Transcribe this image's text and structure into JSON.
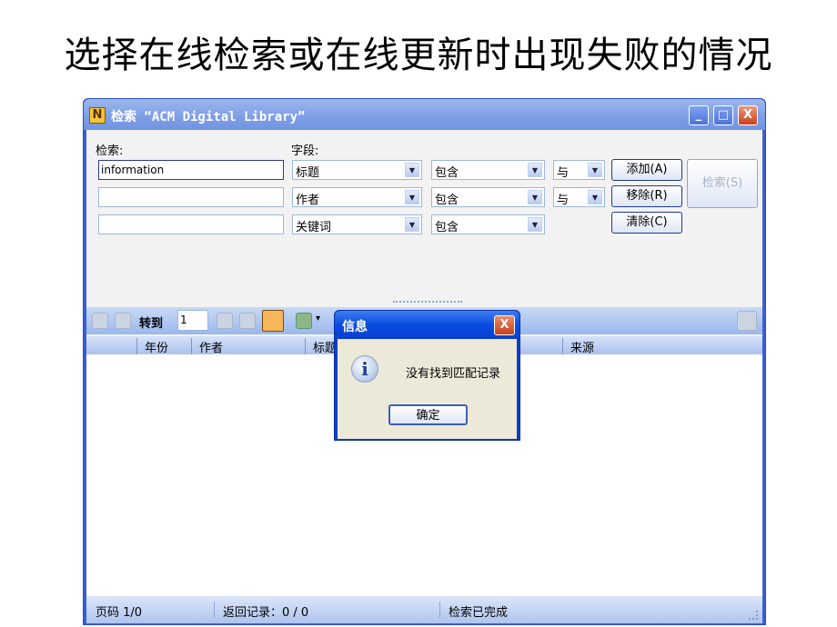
{
  "headline": "选择在线检索或在线更新时出现失败的情况",
  "window": {
    "title": "检索 “ACM Digital Library”",
    "app_icon_letter": "N",
    "min": "_",
    "max": "□",
    "close": "X"
  },
  "form": {
    "search_label": "检索:",
    "field_label": "字段:",
    "rows": [
      {
        "value": "information",
        "field": "标题",
        "op": "包含",
        "logic": "与"
      },
      {
        "value": "",
        "field": "作者",
        "op": "包含",
        "logic": "与"
      },
      {
        "value": "",
        "field": "关键词",
        "op": "包含"
      }
    ],
    "add": "添加(A)",
    "remove": "移除(R)",
    "clear": "清除(C)",
    "search": "检索(S)"
  },
  "toolbar": {
    "goto_label": "转到",
    "goto_value": "1",
    "dropdown_arrow": "▾"
  },
  "columns": [
    "年份",
    "作者",
    "标题",
    "来源"
  ],
  "status": {
    "page": "页码 1/0",
    "records": "返回记录：0 / 0",
    "state": "检索已完成"
  },
  "dialog": {
    "title": "信息",
    "message": "没有找到匹配记录",
    "ok": "确定",
    "icon": "info-icon",
    "close": "X"
  }
}
